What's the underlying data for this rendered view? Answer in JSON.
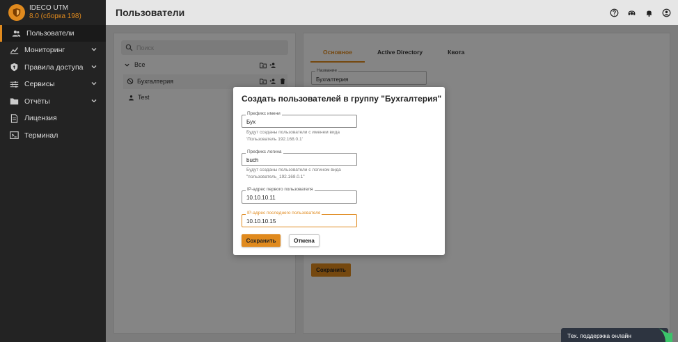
{
  "brand": {
    "name": "IDECO UTM",
    "version": "8.0 (сборка 198)"
  },
  "sidebar": {
    "items": [
      {
        "label": "Пользователи",
        "icon": "users-icon",
        "active": true
      },
      {
        "label": "Мониторинг",
        "icon": "chart-icon",
        "expand": true
      },
      {
        "label": "Правила доступа",
        "icon": "shield-icon",
        "expand": true
      },
      {
        "label": "Сервисы",
        "icon": "sliders-icon",
        "expand": true
      },
      {
        "label": "Отчёты",
        "icon": "folder-icon",
        "expand": true
      },
      {
        "label": "Лицензия",
        "icon": "document-icon"
      },
      {
        "label": "Терминал",
        "icon": "terminal-icon"
      }
    ]
  },
  "header": {
    "title": "Пользователи",
    "icons": [
      "help-icon",
      "support-icon",
      "bell-icon",
      "account-icon"
    ]
  },
  "tree": {
    "search_placeholder": "Поиск",
    "root_label": "Все",
    "group_label": "Бухгалтерия",
    "user_label": "Test"
  },
  "detail": {
    "tabs": [
      "Основное",
      "Active Directory",
      "Квота"
    ],
    "name_label": "Название",
    "name_value": "Бухгалтерия",
    "save_label": "Сохранить"
  },
  "dialog": {
    "title": "Создать пользователей в группу \"Бухгалтерия\"",
    "prefix_name_label": "Префикс имени",
    "prefix_name_value": "Бух",
    "prefix_name_hint": "Будут созданы пользователи с именем вида 'Пользователь 192.168.0.1'",
    "prefix_login_label": "Префикс логина",
    "prefix_login_value": "buch",
    "prefix_login_hint": "Будут созданы пользователи с логином вида \"пользователь_192.168.0.1\"",
    "ip_first_label": "IP-адрес первого пользователя",
    "ip_first_value": "10.10.10.11",
    "ip_last_label": "IP-адрес последнего пользователя",
    "ip_last_value": "10.10.10.15",
    "save_label": "Сохранить",
    "cancel_label": "Отмена"
  },
  "support": {
    "label": "Тех. поддержка онлайн"
  },
  "colors": {
    "accent": "#e08a1e",
    "sidebar": "#232323",
    "support": "#2d3440"
  }
}
